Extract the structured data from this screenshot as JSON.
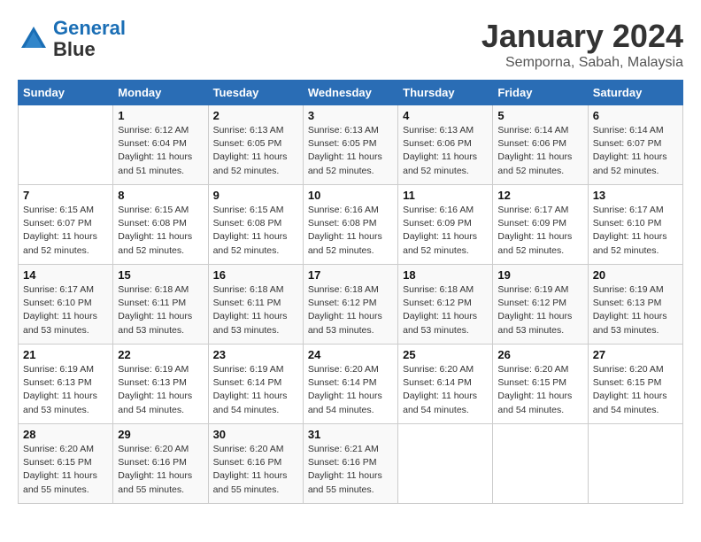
{
  "header": {
    "logo_line1": "General",
    "logo_line2": "Blue",
    "month": "January 2024",
    "location": "Semporna, Sabah, Malaysia"
  },
  "days_of_week": [
    "Sunday",
    "Monday",
    "Tuesday",
    "Wednesday",
    "Thursday",
    "Friday",
    "Saturday"
  ],
  "weeks": [
    [
      {
        "day": "",
        "info": ""
      },
      {
        "day": "1",
        "info": "Sunrise: 6:12 AM\nSunset: 6:04 PM\nDaylight: 11 hours\nand 51 minutes."
      },
      {
        "day": "2",
        "info": "Sunrise: 6:13 AM\nSunset: 6:05 PM\nDaylight: 11 hours\nand 52 minutes."
      },
      {
        "day": "3",
        "info": "Sunrise: 6:13 AM\nSunset: 6:05 PM\nDaylight: 11 hours\nand 52 minutes."
      },
      {
        "day": "4",
        "info": "Sunrise: 6:13 AM\nSunset: 6:06 PM\nDaylight: 11 hours\nand 52 minutes."
      },
      {
        "day": "5",
        "info": "Sunrise: 6:14 AM\nSunset: 6:06 PM\nDaylight: 11 hours\nand 52 minutes."
      },
      {
        "day": "6",
        "info": "Sunrise: 6:14 AM\nSunset: 6:07 PM\nDaylight: 11 hours\nand 52 minutes."
      }
    ],
    [
      {
        "day": "7",
        "info": "Sunrise: 6:15 AM\nSunset: 6:07 PM\nDaylight: 11 hours\nand 52 minutes."
      },
      {
        "day": "8",
        "info": "Sunrise: 6:15 AM\nSunset: 6:08 PM\nDaylight: 11 hours\nand 52 minutes."
      },
      {
        "day": "9",
        "info": "Sunrise: 6:15 AM\nSunset: 6:08 PM\nDaylight: 11 hours\nand 52 minutes."
      },
      {
        "day": "10",
        "info": "Sunrise: 6:16 AM\nSunset: 6:08 PM\nDaylight: 11 hours\nand 52 minutes."
      },
      {
        "day": "11",
        "info": "Sunrise: 6:16 AM\nSunset: 6:09 PM\nDaylight: 11 hours\nand 52 minutes."
      },
      {
        "day": "12",
        "info": "Sunrise: 6:17 AM\nSunset: 6:09 PM\nDaylight: 11 hours\nand 52 minutes."
      },
      {
        "day": "13",
        "info": "Sunrise: 6:17 AM\nSunset: 6:10 PM\nDaylight: 11 hours\nand 52 minutes."
      }
    ],
    [
      {
        "day": "14",
        "info": "Sunrise: 6:17 AM\nSunset: 6:10 PM\nDaylight: 11 hours\nand 53 minutes."
      },
      {
        "day": "15",
        "info": "Sunrise: 6:18 AM\nSunset: 6:11 PM\nDaylight: 11 hours\nand 53 minutes."
      },
      {
        "day": "16",
        "info": "Sunrise: 6:18 AM\nSunset: 6:11 PM\nDaylight: 11 hours\nand 53 minutes."
      },
      {
        "day": "17",
        "info": "Sunrise: 6:18 AM\nSunset: 6:12 PM\nDaylight: 11 hours\nand 53 minutes."
      },
      {
        "day": "18",
        "info": "Sunrise: 6:18 AM\nSunset: 6:12 PM\nDaylight: 11 hours\nand 53 minutes."
      },
      {
        "day": "19",
        "info": "Sunrise: 6:19 AM\nSunset: 6:12 PM\nDaylight: 11 hours\nand 53 minutes."
      },
      {
        "day": "20",
        "info": "Sunrise: 6:19 AM\nSunset: 6:13 PM\nDaylight: 11 hours\nand 53 minutes."
      }
    ],
    [
      {
        "day": "21",
        "info": "Sunrise: 6:19 AM\nSunset: 6:13 PM\nDaylight: 11 hours\nand 53 minutes."
      },
      {
        "day": "22",
        "info": "Sunrise: 6:19 AM\nSunset: 6:13 PM\nDaylight: 11 hours\nand 54 minutes."
      },
      {
        "day": "23",
        "info": "Sunrise: 6:19 AM\nSunset: 6:14 PM\nDaylight: 11 hours\nand 54 minutes."
      },
      {
        "day": "24",
        "info": "Sunrise: 6:20 AM\nSunset: 6:14 PM\nDaylight: 11 hours\nand 54 minutes."
      },
      {
        "day": "25",
        "info": "Sunrise: 6:20 AM\nSunset: 6:14 PM\nDaylight: 11 hours\nand 54 minutes."
      },
      {
        "day": "26",
        "info": "Sunrise: 6:20 AM\nSunset: 6:15 PM\nDaylight: 11 hours\nand 54 minutes."
      },
      {
        "day": "27",
        "info": "Sunrise: 6:20 AM\nSunset: 6:15 PM\nDaylight: 11 hours\nand 54 minutes."
      }
    ],
    [
      {
        "day": "28",
        "info": "Sunrise: 6:20 AM\nSunset: 6:15 PM\nDaylight: 11 hours\nand 55 minutes."
      },
      {
        "day": "29",
        "info": "Sunrise: 6:20 AM\nSunset: 6:16 PM\nDaylight: 11 hours\nand 55 minutes."
      },
      {
        "day": "30",
        "info": "Sunrise: 6:20 AM\nSunset: 6:16 PM\nDaylight: 11 hours\nand 55 minutes."
      },
      {
        "day": "31",
        "info": "Sunrise: 6:21 AM\nSunset: 6:16 PM\nDaylight: 11 hours\nand 55 minutes."
      },
      {
        "day": "",
        "info": ""
      },
      {
        "day": "",
        "info": ""
      },
      {
        "day": "",
        "info": ""
      }
    ]
  ]
}
